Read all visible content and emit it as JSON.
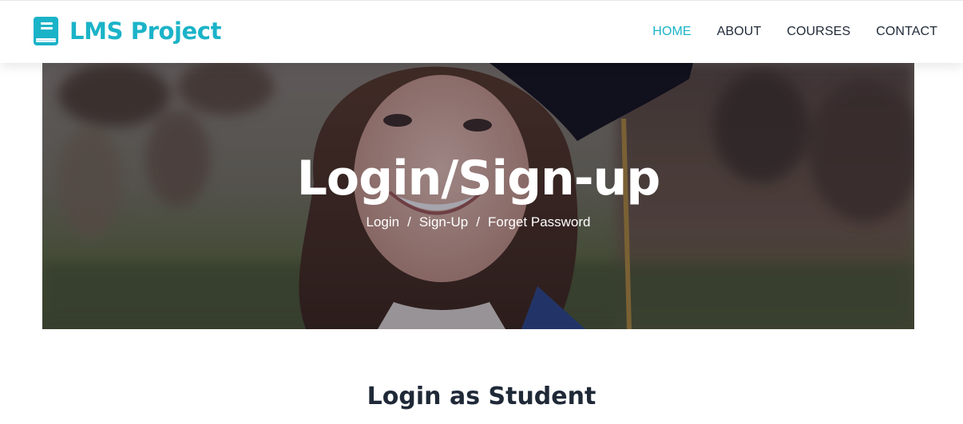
{
  "colors": {
    "brand": "#1bb3c8",
    "nav_active": "#1bb3c8",
    "nav_default": "#1f2937",
    "heading": "#1f2937"
  },
  "navbar": {
    "brand": {
      "icon": "book-icon",
      "title": "LMS Project"
    },
    "links": [
      {
        "label": "HOME",
        "active": true
      },
      {
        "label": "ABOUT",
        "active": false
      },
      {
        "label": "COURSES",
        "active": false
      },
      {
        "label": "CONTACT",
        "active": false
      }
    ]
  },
  "hero": {
    "image": "graduate-photo",
    "title": "Login/Sign-up",
    "breadcrumb": {
      "items": [
        "Login",
        "Sign-Up",
        "Forget Password"
      ],
      "separator": "/"
    }
  },
  "login_section": {
    "title": "Login as Student"
  }
}
